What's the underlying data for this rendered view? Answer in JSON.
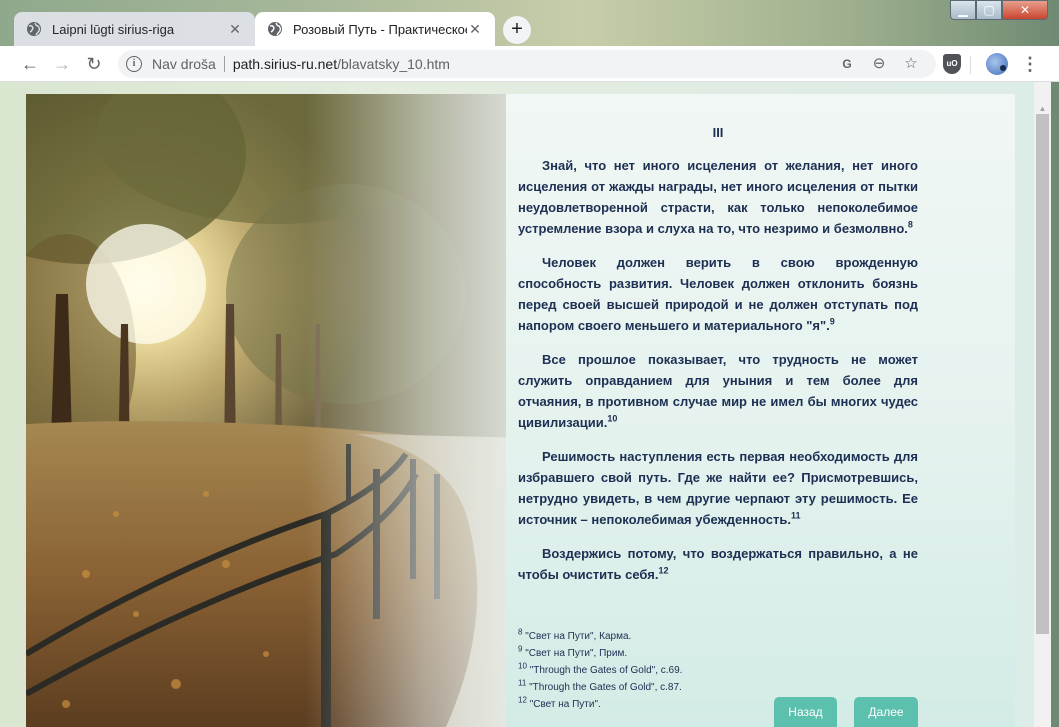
{
  "tabs": [
    {
      "title": "Laipni lūgti sirius-riga",
      "icon": "globe-icon",
      "active": false
    },
    {
      "title": "Розовый Путь - Практическое с",
      "icon": "globe-icon",
      "active": true
    }
  ],
  "toolbar": {
    "security_label": "Nav droša",
    "url_host": "path.sirius-ru.net",
    "url_path": "/blavatsky_10.htm",
    "extension_label": "uO"
  },
  "article": {
    "chapter": "III",
    "paragraphs": [
      {
        "text": "Знай, что нет иного исцеления от желания, нет иного исцеления от жажды награды, нет иного исцеления от пытки неудовлетворенной страсти, как только непоколебимое устремление взора и слуха на то, что незримо и безмолвно.",
        "note": "8"
      },
      {
        "text": "Человек должен верить в свою врожденную способность развития. Человек должен отклонить боязнь перед своей высшей природой и не должен отступать под напором своего меньшего и материального \"я\".",
        "note": "9"
      },
      {
        "text": "Все прошлое показывает, что трудность не может служить оправданием для уныния и тем более для отчаяния, в противном случае мир не имел бы многих чудес цивилизации.",
        "note": "10"
      },
      {
        "text": "Решимость наступления есть первая необходимость для избравшего свой путь. Где же найти ее? Присмотревшись, нетрудно увидеть, в чем другие черпают эту решимость. Ее источник – непоколебимая убежденность.",
        "note": "11"
      },
      {
        "text": "Воздержись потому, что воздержаться правильно, а не чтобы очистить себя.",
        "note": "12"
      }
    ],
    "footnotes": [
      {
        "num": "8",
        "text": "\"Свет на Пути\", Карма."
      },
      {
        "num": "9",
        "text": "\"Свет на Пути\", Прим."
      },
      {
        "num": "10",
        "text": "\"Through the Gates of Gold\", с.69."
      },
      {
        "num": "11",
        "text": "\"Through the Gates of Gold\", с.87."
      },
      {
        "num": "12",
        "text": "\"Свет на Пути\"."
      }
    ]
  },
  "nav": {
    "back_label": "Назад",
    "next_label": "Далее"
  },
  "colors": {
    "text": "#1d2f52",
    "button": "#5cc0ae"
  }
}
